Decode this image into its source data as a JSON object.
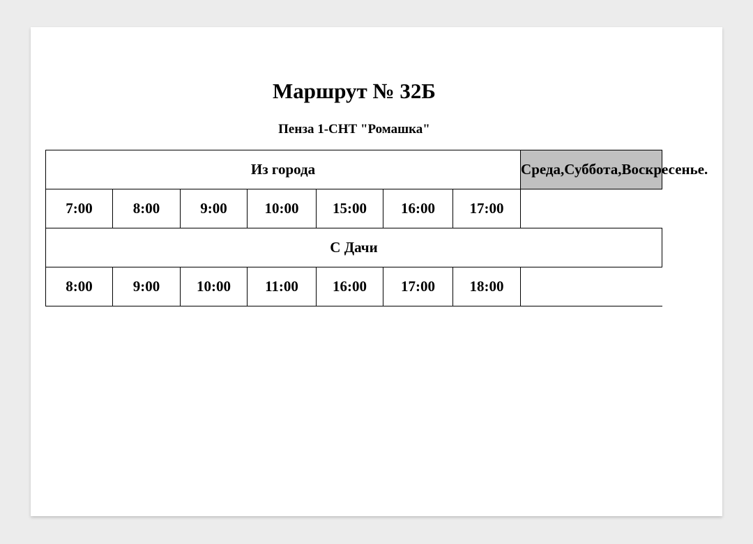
{
  "document": {
    "title": "Маршрут № 32Б",
    "subtitle": "Пенза 1-СНТ \"Ромашка\""
  },
  "schedule": {
    "days_badge": "Среда,Суббота,Воскресенье.",
    "from_city": {
      "label": "Из города",
      "times": [
        "7:00",
        "8:00",
        "9:00",
        "10:00",
        "15:00",
        "16:00",
        "17:00"
      ]
    },
    "from_dacha": {
      "label": "С Дачи",
      "times": [
        "8:00",
        "9:00",
        "10:00",
        "11:00",
        "16:00",
        "17:00",
        "18:00"
      ]
    }
  },
  "colors": {
    "page_background": "#ffffff",
    "viewer_background": "#ececec",
    "days_cell_background": "#c0c0c0",
    "text": "#000000"
  }
}
